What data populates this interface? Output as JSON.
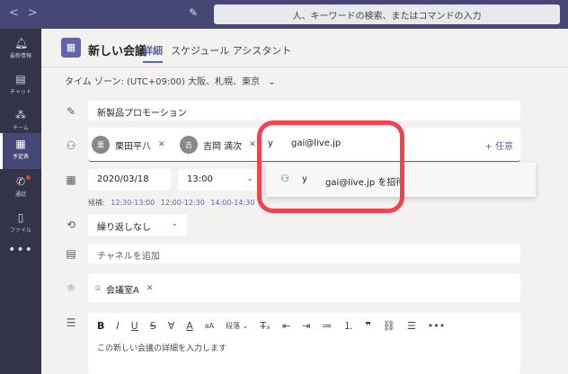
{
  "topbar": {
    "search_placeholder": "人、キーワードの検索、またはコマンドの入力"
  },
  "rail": {
    "items": [
      {
        "label": "最新情報",
        "icon": "bell-icon"
      },
      {
        "label": "チャット",
        "icon": "chat-icon"
      },
      {
        "label": "チーム",
        "icon": "teams-icon"
      },
      {
        "label": "予定表",
        "icon": "calendar-icon"
      },
      {
        "label": "通話",
        "icon": "phone-icon"
      },
      {
        "label": "ファイル",
        "icon": "file-icon"
      }
    ],
    "active": "予定表"
  },
  "header": {
    "title": "新しい会議",
    "tabs": [
      {
        "label": "詳細",
        "active": true
      },
      {
        "label": "スケジュール アシスタント",
        "active": false
      }
    ]
  },
  "timezone": {
    "label": "タイム ゾーン: (UTC+09:00) 大阪、札幌、東京"
  },
  "form": {
    "title_value": "新製品プロモーション",
    "attendees": [
      {
        "name": "栗田平八",
        "initials": "栗"
      },
      {
        "name": "吉岡 満次",
        "initials": "吉"
      }
    ],
    "typed_prefix": "y",
    "typed_email": "gai@live.jp",
    "optional_label": "+ 任意",
    "date_value": "2020/03/18",
    "time_value": "13:00",
    "candidates_label": "候補:",
    "candidate_slots": [
      "12:30-13:00",
      "12:00-12:30",
      "14:00-14:30"
    ],
    "repeat_value": "繰り返しなし",
    "channel_placeholder": "チャネルを追加",
    "location_value": "会議室A",
    "editor_placeholder": "この新しい会議の詳細を入力します",
    "toolbar_paragraph": "段落"
  },
  "suggestion": {
    "prefix": "y",
    "text": "gai@live.jp を招待"
  },
  "colors": {
    "accent": "#6264a7",
    "highlight": "#ef4450",
    "topbar": "#464775",
    "rail": "#33344a"
  }
}
